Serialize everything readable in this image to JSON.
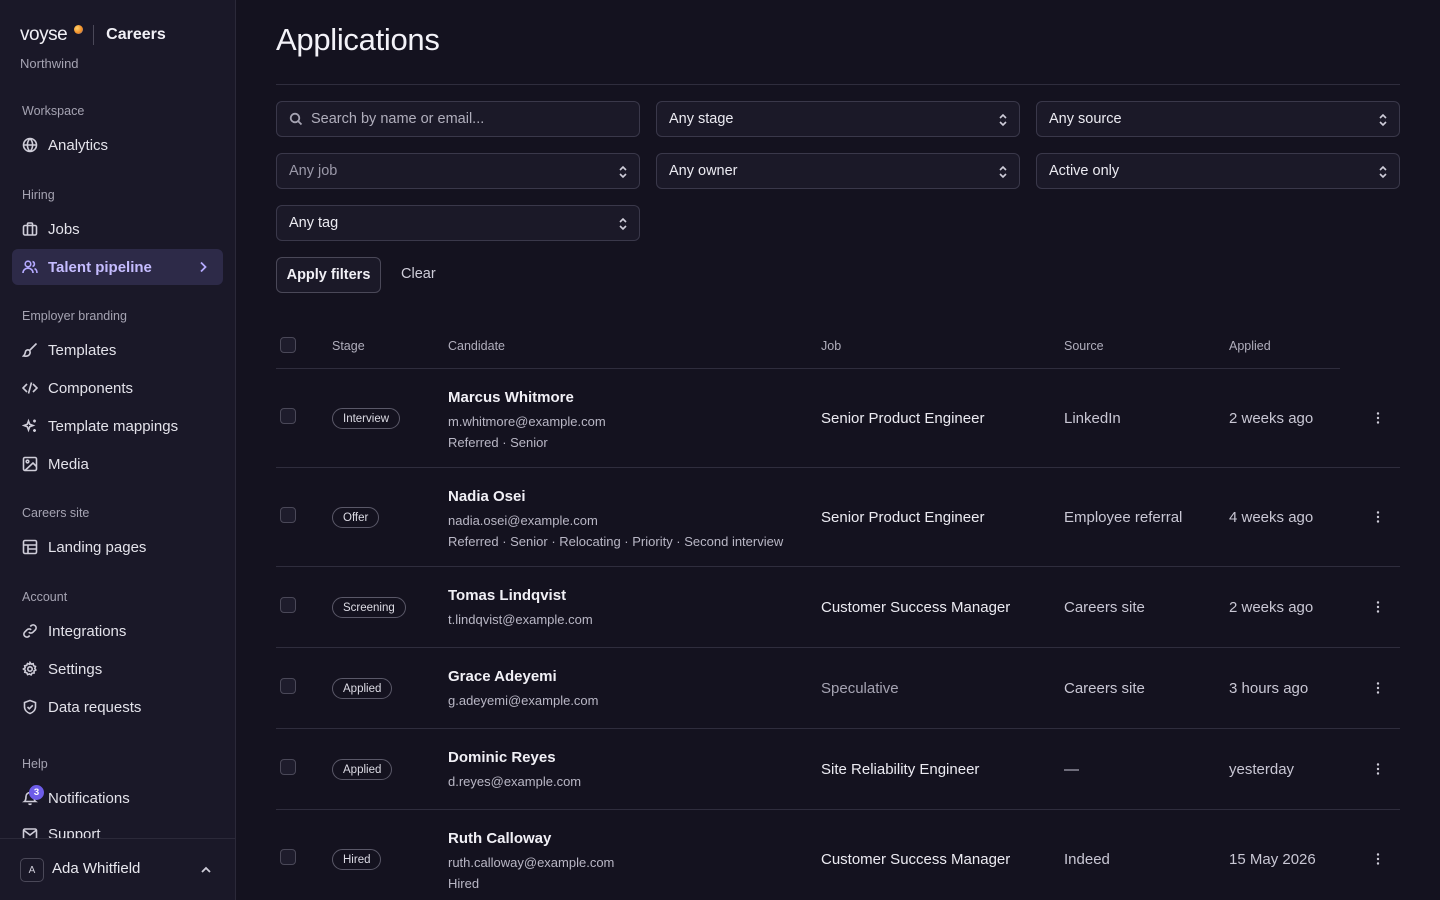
{
  "brand": {
    "logo": "voyse",
    "product": "Careers",
    "org": "Northwind"
  },
  "sidebar": {
    "sections": {
      "workspace": "Workspace",
      "hiring": "Hiring",
      "branding": "Employer branding",
      "site": "Careers site",
      "account": "Account",
      "help": "Help"
    },
    "items": {
      "analytics": "Analytics",
      "jobs": "Jobs",
      "talent": "Talent pipeline",
      "templates": "Templates",
      "components": "Components",
      "mappings": "Template mappings",
      "media": "Media",
      "landing": "Landing pages",
      "integrations": "Integrations",
      "settings": "Settings",
      "data_requests": "Data requests",
      "notifications": "Notifications",
      "support": "Support"
    },
    "notifications_count": "3",
    "user": {
      "initial": "A",
      "name": "Ada Whitfield"
    }
  },
  "page": {
    "title": "Applications"
  },
  "filters": {
    "search_placeholder": "Search by name or email...",
    "stage": "Any stage",
    "source": "Any source",
    "job": "Any job",
    "owner": "Any owner",
    "status": "Active only",
    "tag": "Any tag",
    "apply_label": "Apply filters",
    "clear_label": "Clear"
  },
  "table": {
    "headers": {
      "stage": "Stage",
      "candidate": "Candidate",
      "job": "Job",
      "source": "Source",
      "applied": "Applied"
    },
    "rows": [
      {
        "stage": "Interview",
        "name": "Marcus Whitmore",
        "email": "m.whitmore@example.com",
        "tags": "Referred · Senior",
        "job": "Senior Product Engineer",
        "source": "LinkedIn",
        "applied": "2 weeks ago"
      },
      {
        "stage": "Offer",
        "name": "Nadia Osei",
        "email": "nadia.osei@example.com",
        "tags": "Referred · Senior · Relocating · Priority · Second interview",
        "job": "Senior Product Engineer",
        "source": "Employee referral",
        "applied": "4 weeks ago"
      },
      {
        "stage": "Screening",
        "name": "Tomas Lindqvist",
        "email": "t.lindqvist@example.com",
        "tags": "",
        "job": "Customer Success Manager",
        "source": "Careers site",
        "applied": "2 weeks ago"
      },
      {
        "stage": "Applied",
        "name": "Grace Adeyemi",
        "email": "g.adeyemi@example.com",
        "tags": "",
        "job": "Speculative",
        "source": "Careers site",
        "applied": "3 hours ago"
      },
      {
        "stage": "Applied",
        "name": "Dominic Reyes",
        "email": "d.reyes@example.com",
        "tags": "",
        "job": "Site Reliability Engineer",
        "source": "—",
        "applied": "yesterday"
      },
      {
        "stage": "Hired",
        "name": "Ruth Calloway",
        "email": "ruth.calloway@example.com",
        "tags": "Hired",
        "job": "Customer Success Manager",
        "source": "Indeed",
        "applied": "15 May 2026"
      }
    ]
  },
  "colors": {
    "background": "#14121f",
    "sidebar": "#1a1828",
    "accent": "#6d5ce8",
    "active_text": "#c5bcff"
  }
}
